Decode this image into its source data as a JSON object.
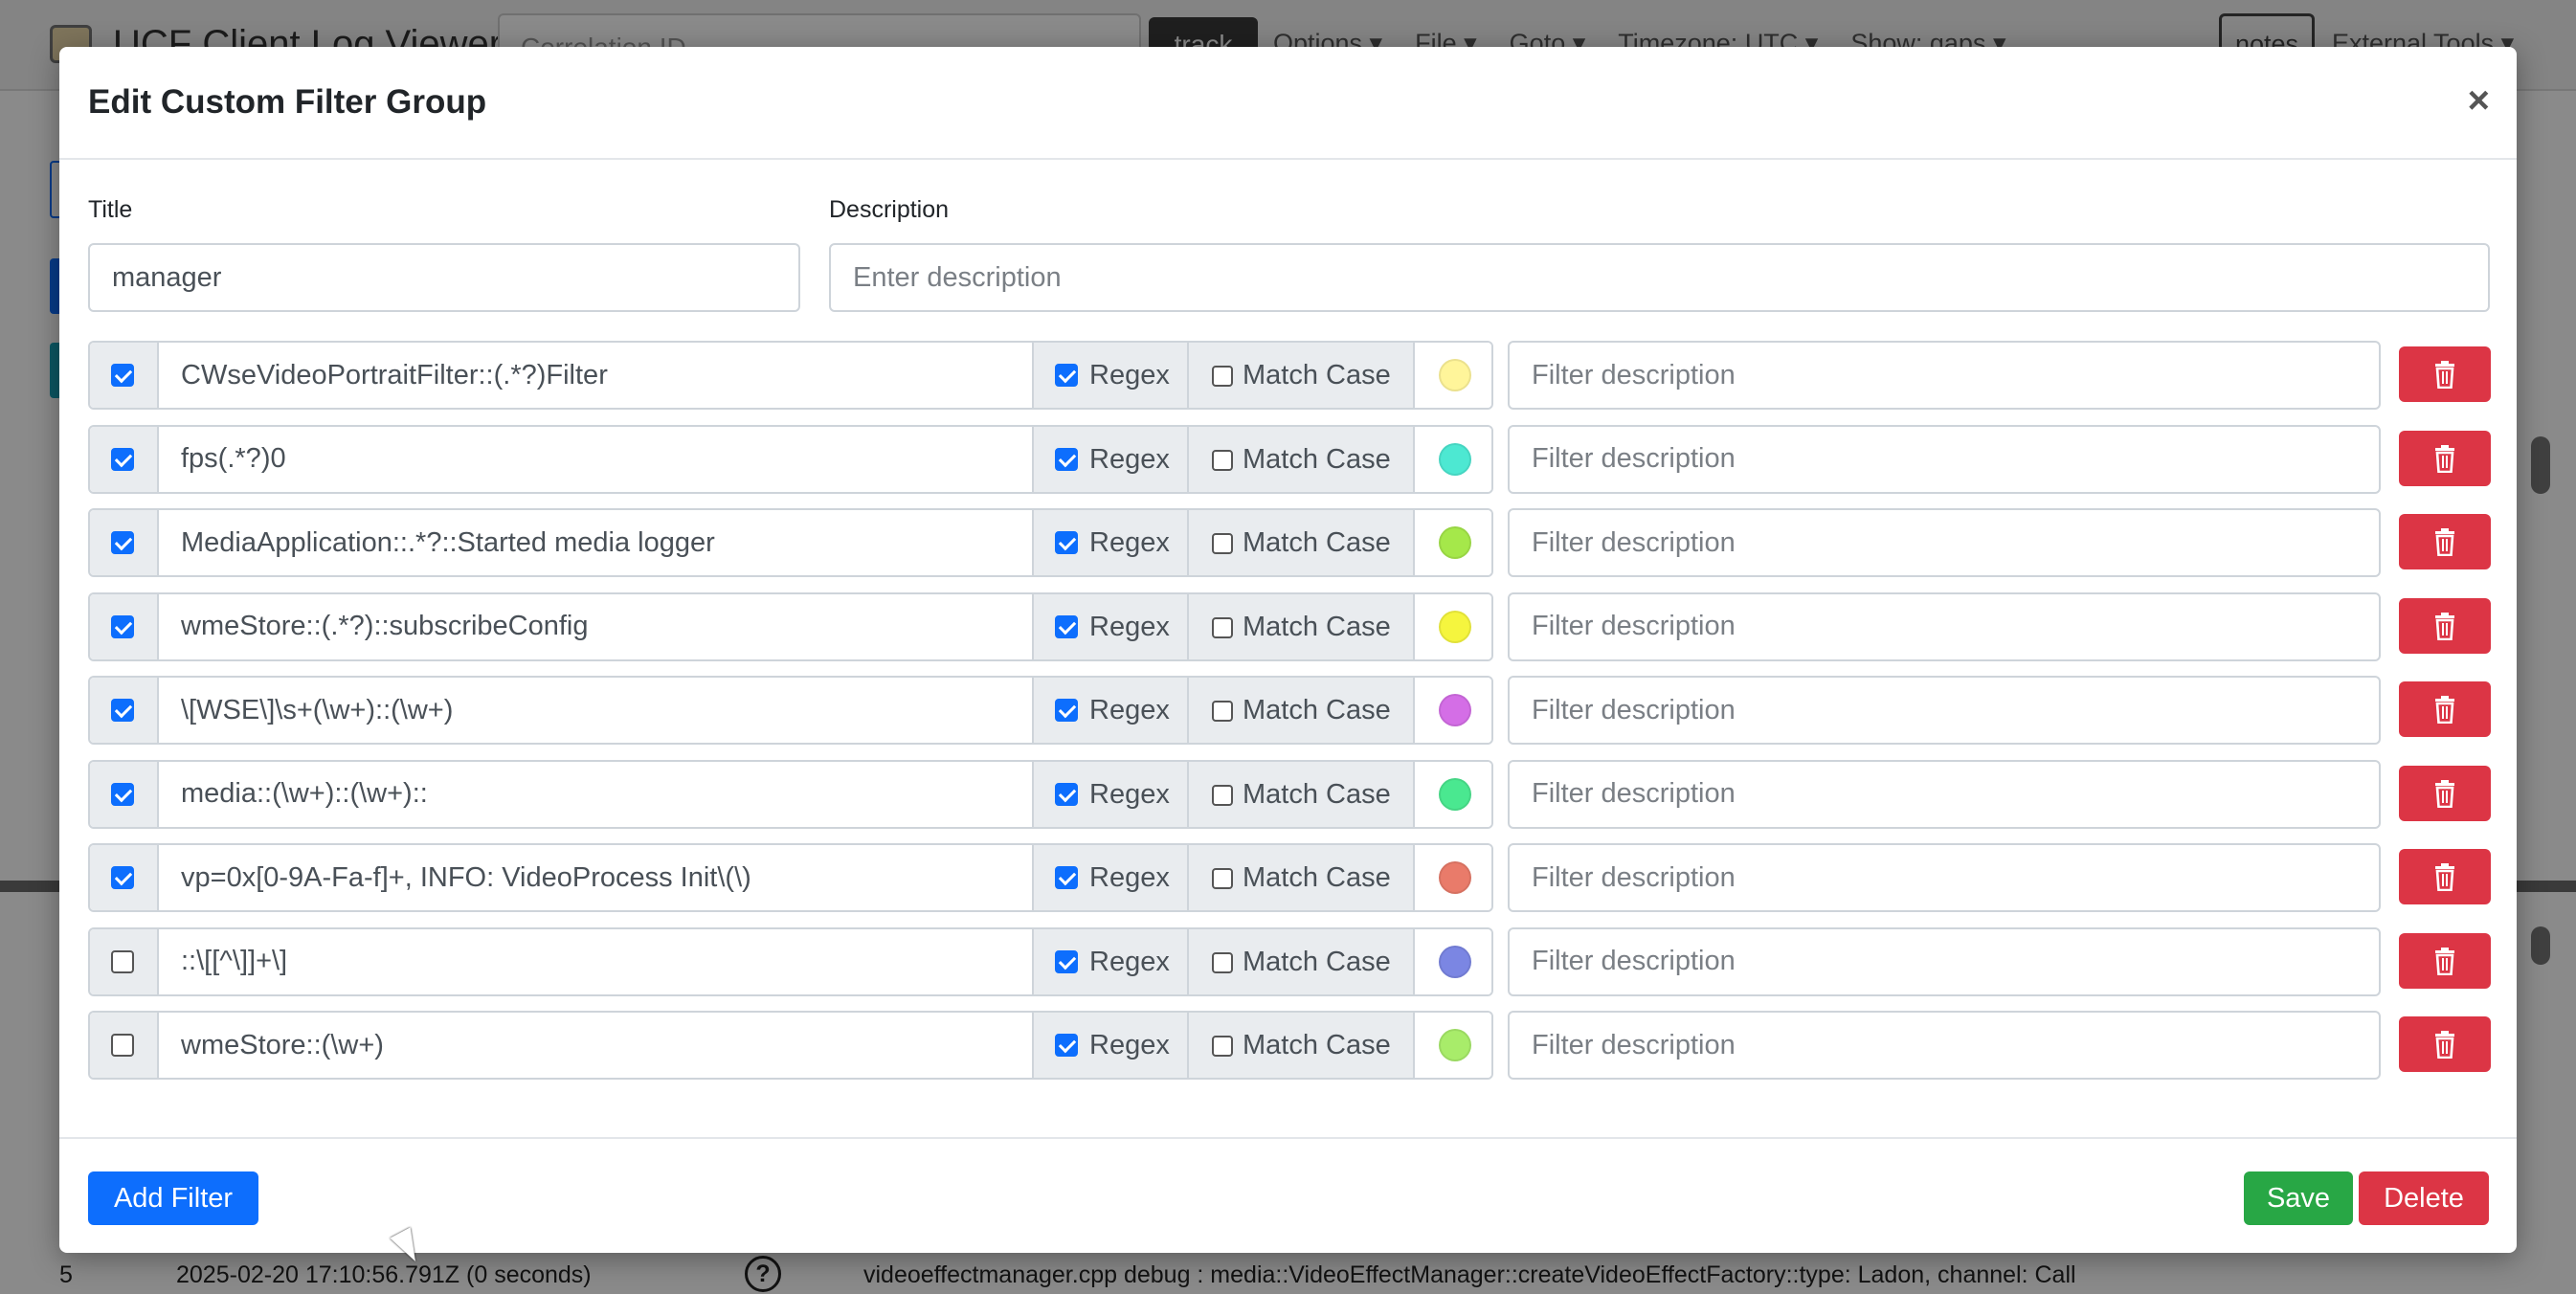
{
  "background_app": {
    "title": "UCF Client Log Viewer",
    "correlation_placeholder": "Correlation ID",
    "track_label": "track",
    "menus": [
      "Options ▾",
      "File ▾",
      "Goto ▾",
      "Timezone: UTC ▾",
      "Show: gaps ▾"
    ],
    "notes_label": "notes",
    "external_tools_label": "External Tools ▾",
    "log_row": {
      "index": "5",
      "timestamp": "2025-02-20 17:10:56.791Z (0 seconds)",
      "help_glyph": "?",
      "message": "videoeffectmanager.cpp debug : media::VideoEffectManager::createVideoEffectFactory::type: Ladon, channel: Call"
    }
  },
  "modal": {
    "title": "Edit Custom Filter Group",
    "close_glyph": "×",
    "title_label": "Title",
    "title_value": "manager",
    "description_label": "Description",
    "description_placeholder": "Enter description",
    "regex_label": "Regex",
    "match_case_label": "Match Case",
    "filter_description_placeholder": "Filter description",
    "filters": [
      {
        "enabled": true,
        "pattern": "CWseVideoPortraitFilter::(.*?)Filter",
        "regex": true,
        "match_case": false,
        "color": "#fff59a"
      },
      {
        "enabled": true,
        "pattern": "fps(.*?)0",
        "regex": true,
        "match_case": false,
        "color": "#4de8d2"
      },
      {
        "enabled": true,
        "pattern": "MediaApplication::.*?::Started media logger",
        "regex": true,
        "match_case": false,
        "color": "#a5e84a"
      },
      {
        "enabled": true,
        "pattern": "wmeStore::(.*?)::subscribeConfig",
        "regex": true,
        "match_case": false,
        "color": "#f5f53e"
      },
      {
        "enabled": true,
        "pattern": "\\[WSE\\]\\s+(\\w+)::(\\w+)",
        "regex": true,
        "match_case": false,
        "color": "#d46ee6"
      },
      {
        "enabled": true,
        "pattern": "media::(\\w+)::(\\w+)::",
        "regex": true,
        "match_case": false,
        "color": "#4ae890"
      },
      {
        "enabled": true,
        "pattern": "vp=0x[0-9A-Fa-f]+, INFO: VideoProcess Init\\(\\)",
        "regex": true,
        "match_case": false,
        "color": "#e97b6a"
      },
      {
        "enabled": false,
        "pattern": "::\\[[^\\]]+\\]",
        "regex": true,
        "match_case": false,
        "color": "#7b86e3"
      },
      {
        "enabled": false,
        "pattern": "wmeStore::(\\w+)",
        "regex": true,
        "match_case": false,
        "color": "#a8ec6a"
      }
    ],
    "add_filter_label": "Add Filter",
    "save_label": "Save",
    "delete_label": "Delete"
  }
}
